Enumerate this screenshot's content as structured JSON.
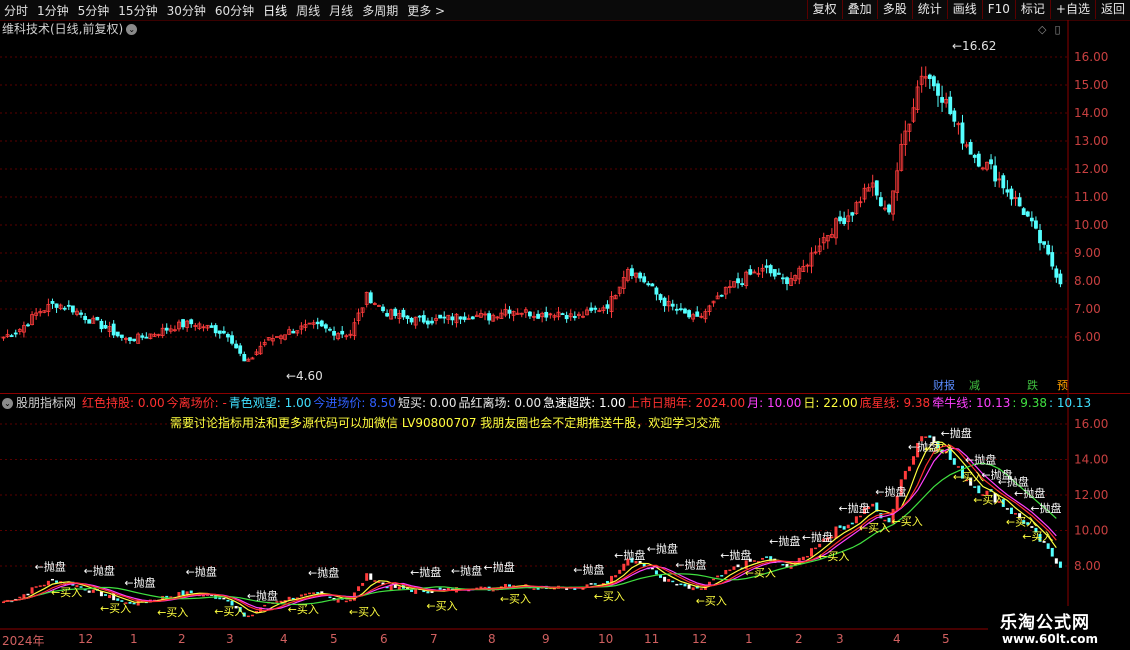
{
  "toolbar": {
    "periods": [
      "分时",
      "1分钟",
      "5分钟",
      "15分钟",
      "30分钟",
      "60分钟",
      "日线",
      "周线",
      "月线",
      "多周期",
      "更多 >"
    ],
    "active_period": "日线",
    "buttons": [
      "复权",
      "叠加",
      "多股",
      "统计",
      "画线",
      "F10",
      "标记",
      "+自选",
      "返回"
    ]
  },
  "main": {
    "title": "维科技术(日线,前复权)",
    "high_label": "16.62",
    "low_label": "4.60",
    "y_ticks": [
      "16.00",
      "15.00",
      "14.00",
      "13.00",
      "12.00",
      "11.00",
      "10.00",
      "9.00",
      "8.00",
      "7.00",
      "6.00"
    ],
    "badges": [
      {
        "text": "财报",
        "color": "#5a8cff"
      },
      {
        "text": "减",
        "color": "#40c040"
      },
      {
        "text": "跌",
        "color": "#40c040"
      },
      {
        "text": "预",
        "color": "#ffa000"
      }
    ]
  },
  "indicator": {
    "name": "股朋指标网",
    "fields": [
      {
        "text": "红色持股: 0.00",
        "color": "#ff3030"
      },
      {
        "text": "今离场价: -",
        "color": "#ff3030"
      },
      {
        "text": "青色观望: 1.00",
        "color": "#40e0ff"
      },
      {
        "text": "今进场价: 8.50",
        "color": "#3060ff"
      },
      {
        "text": "短买: 0.00",
        "color": "#e8e8e8"
      },
      {
        "text": "品红离场: 0.00",
        "color": "#e8e8e8"
      },
      {
        "text": "急速超跌: 1.00",
        "color": "#ffffff"
      },
      {
        "text": "上市日期年: 2024.00",
        "color": "#ff3030"
      },
      {
        "text": "月: 10.00",
        "color": "#ff40ff"
      },
      {
        "text": "日: 22.00",
        "color": "#ffff40"
      },
      {
        "text": "底星线: 9.38",
        "color": "#ff3030"
      },
      {
        "text": "牵牛线: 10.13",
        "color": "#ff40ff"
      },
      {
        "text": ": 9.38",
        "color": "#40e040"
      },
      {
        "text": ": 10.13",
        "color": "#40e0ff"
      }
    ],
    "notice": "需要讨论指标用法和更多源代码可以加微信 LV90800707  我朋友圈也会不定期推送牛股，欢迎学习交流",
    "y_ticks": [
      "16.00",
      "14.00",
      "12.00",
      "10.00",
      "8.00"
    ],
    "sell_label": "抛盘",
    "buy_label": "买入"
  },
  "date_axis": [
    "2024年",
    "12",
    "1",
    "2",
    "3",
    "4",
    "5",
    "6",
    "7",
    "8",
    "9",
    "10",
    "11",
    "12",
    "1",
    "2",
    "3",
    "4",
    "5"
  ],
  "logo": {
    "title": "乐淘公式网",
    "url": "www.60lt.com"
  },
  "chart_data": {
    "type": "candlestick",
    "title": "维科技术(日线,前复权)",
    "ylim": [
      5.2,
      16.9
    ],
    "y_ticks": [
      6,
      7,
      8,
      9,
      10,
      11,
      12,
      13,
      14,
      15,
      16
    ],
    "high": 16.62,
    "low": 4.6,
    "approx_close_path": [
      6.0,
      6.3,
      6.9,
      7.2,
      7.0,
      6.6,
      6.3,
      5.9,
      6.0,
      6.2,
      6.4,
      6.5,
      6.3,
      6.1,
      5.0,
      5.8,
      6.1,
      6.3,
      6.4,
      6.2,
      6.1,
      7.5,
      6.9,
      6.7,
      6.6,
      6.6,
      6.7,
      6.8,
      6.7,
      7.0,
      6.9,
      6.8,
      6.9,
      6.7,
      6.9,
      7.2,
      8.5,
      8.0,
      7.3,
      6.9,
      6.6,
      7.2,
      7.8,
      8.2,
      8.4,
      8.0,
      8.3,
      9.3,
      10.0,
      10.5,
      11.5,
      10.3,
      13.2,
      15.5,
      14.9,
      13.5,
      12.5,
      12.0,
      11.2,
      10.4,
      9.2,
      8.0
    ]
  }
}
